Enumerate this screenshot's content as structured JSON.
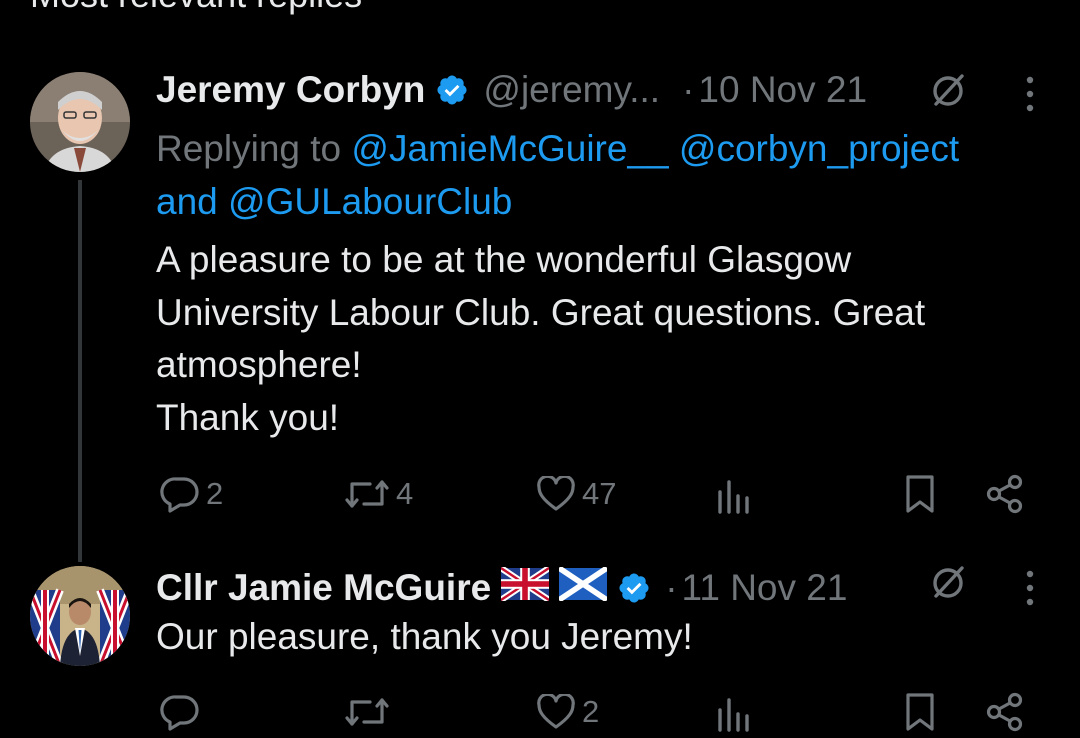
{
  "section_header": "Most relevant replies",
  "tweets": [
    {
      "display_name": "Jeremy Corbyn",
      "handle": "@jeremy...",
      "separator": "·",
      "date": "10 Nov 21",
      "replying_prefix": "Replying to",
      "mentions": [
        "@JamieMcGuire__",
        "@corbyn_project",
        "@GULabourClub"
      ],
      "mention_joiner": "and",
      "text_lines": [
        "A pleasure to be at the wonderful Glasgow",
        "University Labour Club. Great questions. Great",
        "atmosphere!",
        "Thank you!"
      ],
      "actions": {
        "replies": "2",
        "retweets": "4",
        "likes": "47"
      }
    },
    {
      "display_name": "Cllr Jamie McGuire",
      "separator": "·",
      "date": "11 Nov 21",
      "text": "Our pleasure, thank you Jeremy!",
      "actions": {
        "likes": "2"
      }
    }
  ],
  "colors": {
    "background": "#000000",
    "text_primary": "#e7e9ea",
    "text_secondary": "#71767b",
    "link": "#1d9bf0",
    "verified": "#1d9bf0",
    "thread_line": "#333639"
  },
  "icons": [
    "reply-icon",
    "retweet-icon",
    "like-icon",
    "views-icon",
    "bookmark-icon",
    "share-icon",
    "grok-icon",
    "more-icon",
    "verified-badge-icon"
  ]
}
